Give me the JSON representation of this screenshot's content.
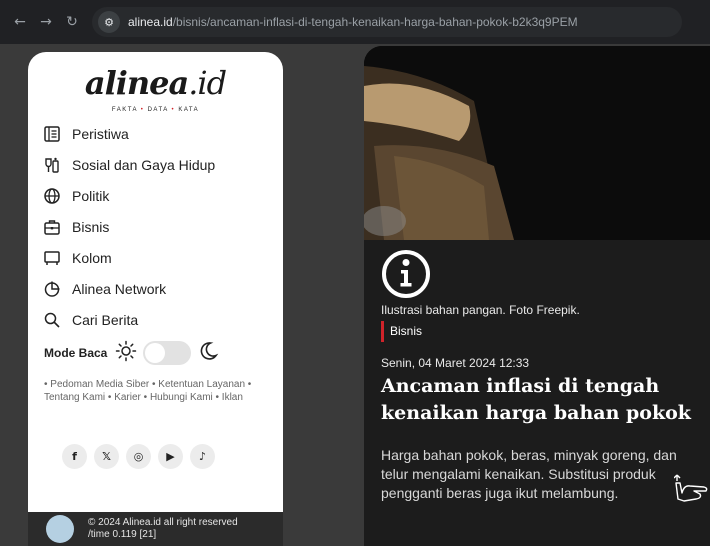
{
  "browser": {
    "url_domain": "alinea.id",
    "url_path": "/bisnis/ancaman-inflasi-di-tengah-kenaikan-harga-bahan-pokok-b2k3q9PEM"
  },
  "logo": {
    "name": "alinea",
    "suffix": ".id",
    "tagline_parts": [
      "FAKTA",
      "DATA",
      "KATA"
    ]
  },
  "menu": [
    {
      "label": "Peristiwa",
      "icon": "newspaper-icon"
    },
    {
      "label": "Sosial dan Gaya Hidup",
      "icon": "lifestyle-icon"
    },
    {
      "label": "Politik",
      "icon": "globe-icon"
    },
    {
      "label": "Bisnis",
      "icon": "briefcase-icon"
    },
    {
      "label": "Kolom",
      "icon": "column-icon"
    },
    {
      "label": "Alinea Network",
      "icon": "network-icon"
    },
    {
      "label": "Cari Berita",
      "icon": "search-icon"
    }
  ],
  "mode": {
    "label": "Mode Baca",
    "dark_enabled": false
  },
  "footer_links": "• Pedoman Media Siber • Ketentuan Layanan • Tentang Kami • Karier • Hubungi Kami • Iklan",
  "socials": [
    {
      "icon": "facebook-icon",
      "glyph": "f"
    },
    {
      "icon": "x-icon",
      "glyph": "𝕏"
    },
    {
      "icon": "instagram-icon",
      "glyph": "◎"
    },
    {
      "icon": "youtube-icon",
      "glyph": "▶"
    },
    {
      "icon": "tiktok-icon",
      "glyph": "♪"
    }
  ],
  "copyright": {
    "line1": "© 2024 Alinea.id all right reserved",
    "line2": "/time 0.119 [21]"
  },
  "article": {
    "caption": "Ilustrasi bahan pangan. Foto Freepik.",
    "category": "Bisnis",
    "date": "Senin, 04 Maret 2024 12:33",
    "headline": "Ancaman inflasi di tengah kenaikan harga bahan pokok",
    "lede": "Harga bahan pokok, beras, minyak goreng, dan telur mengalami kenaikan. Substitusi produk pengganti beras juga ikut melambung."
  },
  "colors": {
    "accent": "#d0232a",
    "article_bg": "#1c1c1c",
    "page_bg": "#3a3a3a"
  }
}
